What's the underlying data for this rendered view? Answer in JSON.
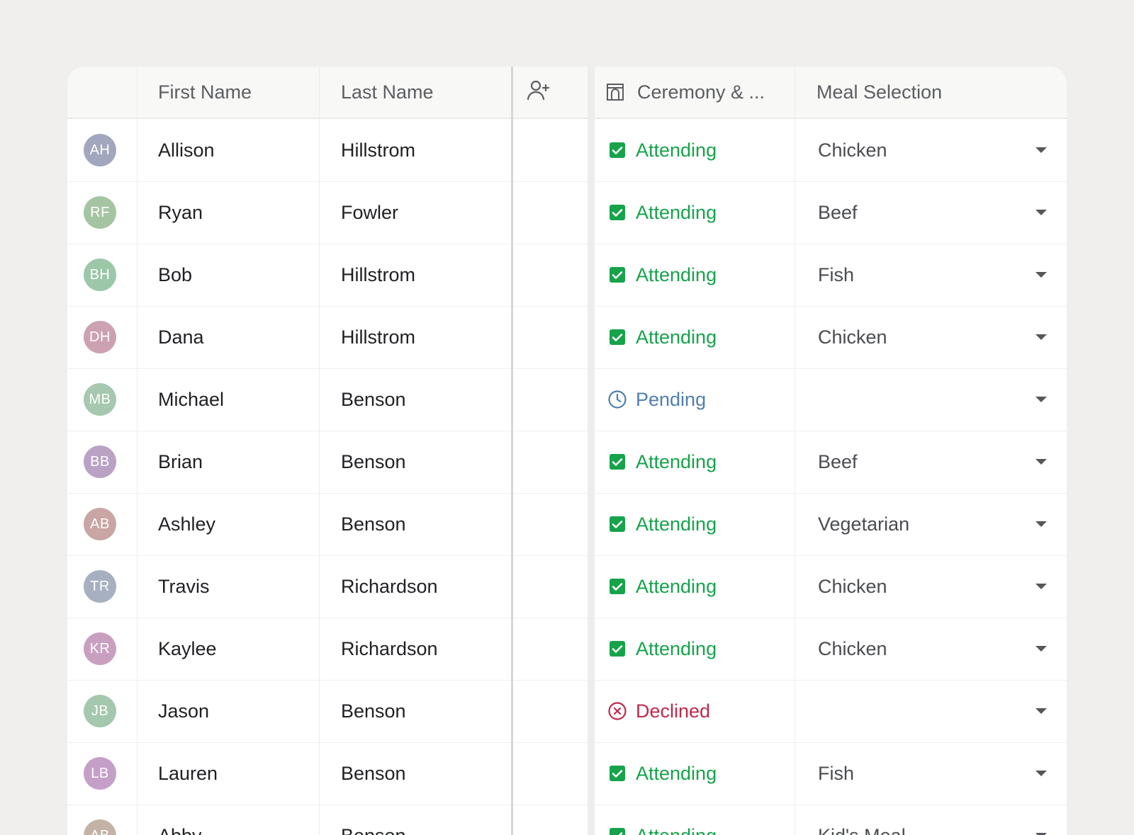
{
  "table": {
    "headers": {
      "first_name": "First Name",
      "last_name": "Last Name",
      "ceremony": "Ceremony & ...",
      "meal": "Meal Selection"
    },
    "icons": {
      "add_guest": "add-person-icon",
      "venue": "venue-icon"
    },
    "colors": {
      "attending": "#16a34a",
      "pending": "#4f7fae",
      "declined": "#c0284a"
    },
    "rows": [
      {
        "initials": "AH",
        "first": "Allison",
        "last": "Hillstrom",
        "status": "Attending",
        "meal": "Chicken",
        "avatar_color": "#a3a7bd"
      },
      {
        "initials": "RF",
        "first": "Ryan",
        "last": "Fowler",
        "status": "Attending",
        "meal": "Beef",
        "avatar_color": "#a5c5a2"
      },
      {
        "initials": "BH",
        "first": "Bob",
        "last": "Hillstrom",
        "status": "Attending",
        "meal": "Fish",
        "avatar_color": "#9cc7a8"
      },
      {
        "initials": "DH",
        "first": "Dana",
        "last": "Hillstrom",
        "status": "Attending",
        "meal": "Chicken",
        "avatar_color": "#cca1b1"
      },
      {
        "initials": "MB",
        "first": "Michael",
        "last": "Benson",
        "status": "Pending",
        "meal": "",
        "avatar_color": "#a5c8ae"
      },
      {
        "initials": "BB",
        "first": "Brian",
        "last": "Benson",
        "status": "Attending",
        "meal": "Beef",
        "avatar_color": "#b9a2c4"
      },
      {
        "initials": "AB",
        "first": "Ashley",
        "last": "Benson",
        "status": "Attending",
        "meal": "Vegetarian",
        "avatar_color": "#c9a5a4"
      },
      {
        "initials": "TR",
        "first": "Travis",
        "last": "Richardson",
        "status": "Attending",
        "meal": "Chicken",
        "avatar_color": "#a7b0c0"
      },
      {
        "initials": "KR",
        "first": "Kaylee",
        "last": "Richardson",
        "status": "Attending",
        "meal": "Chicken",
        "avatar_color": "#c99fc0"
      },
      {
        "initials": "JB",
        "first": "Jason",
        "last": "Benson",
        "status": "Declined",
        "meal": "",
        "avatar_color": "#a3c8ae"
      },
      {
        "initials": "LB",
        "first": "Lauren",
        "last": "Benson",
        "status": "Attending",
        "meal": "Fish",
        "avatar_color": "#c4a0c8"
      },
      {
        "initials": "AB",
        "first": "Abby",
        "last": "Benson",
        "status": "Attending",
        "meal": "Kid's Meal",
        "avatar_color": "#c4b3a4"
      }
    ]
  }
}
